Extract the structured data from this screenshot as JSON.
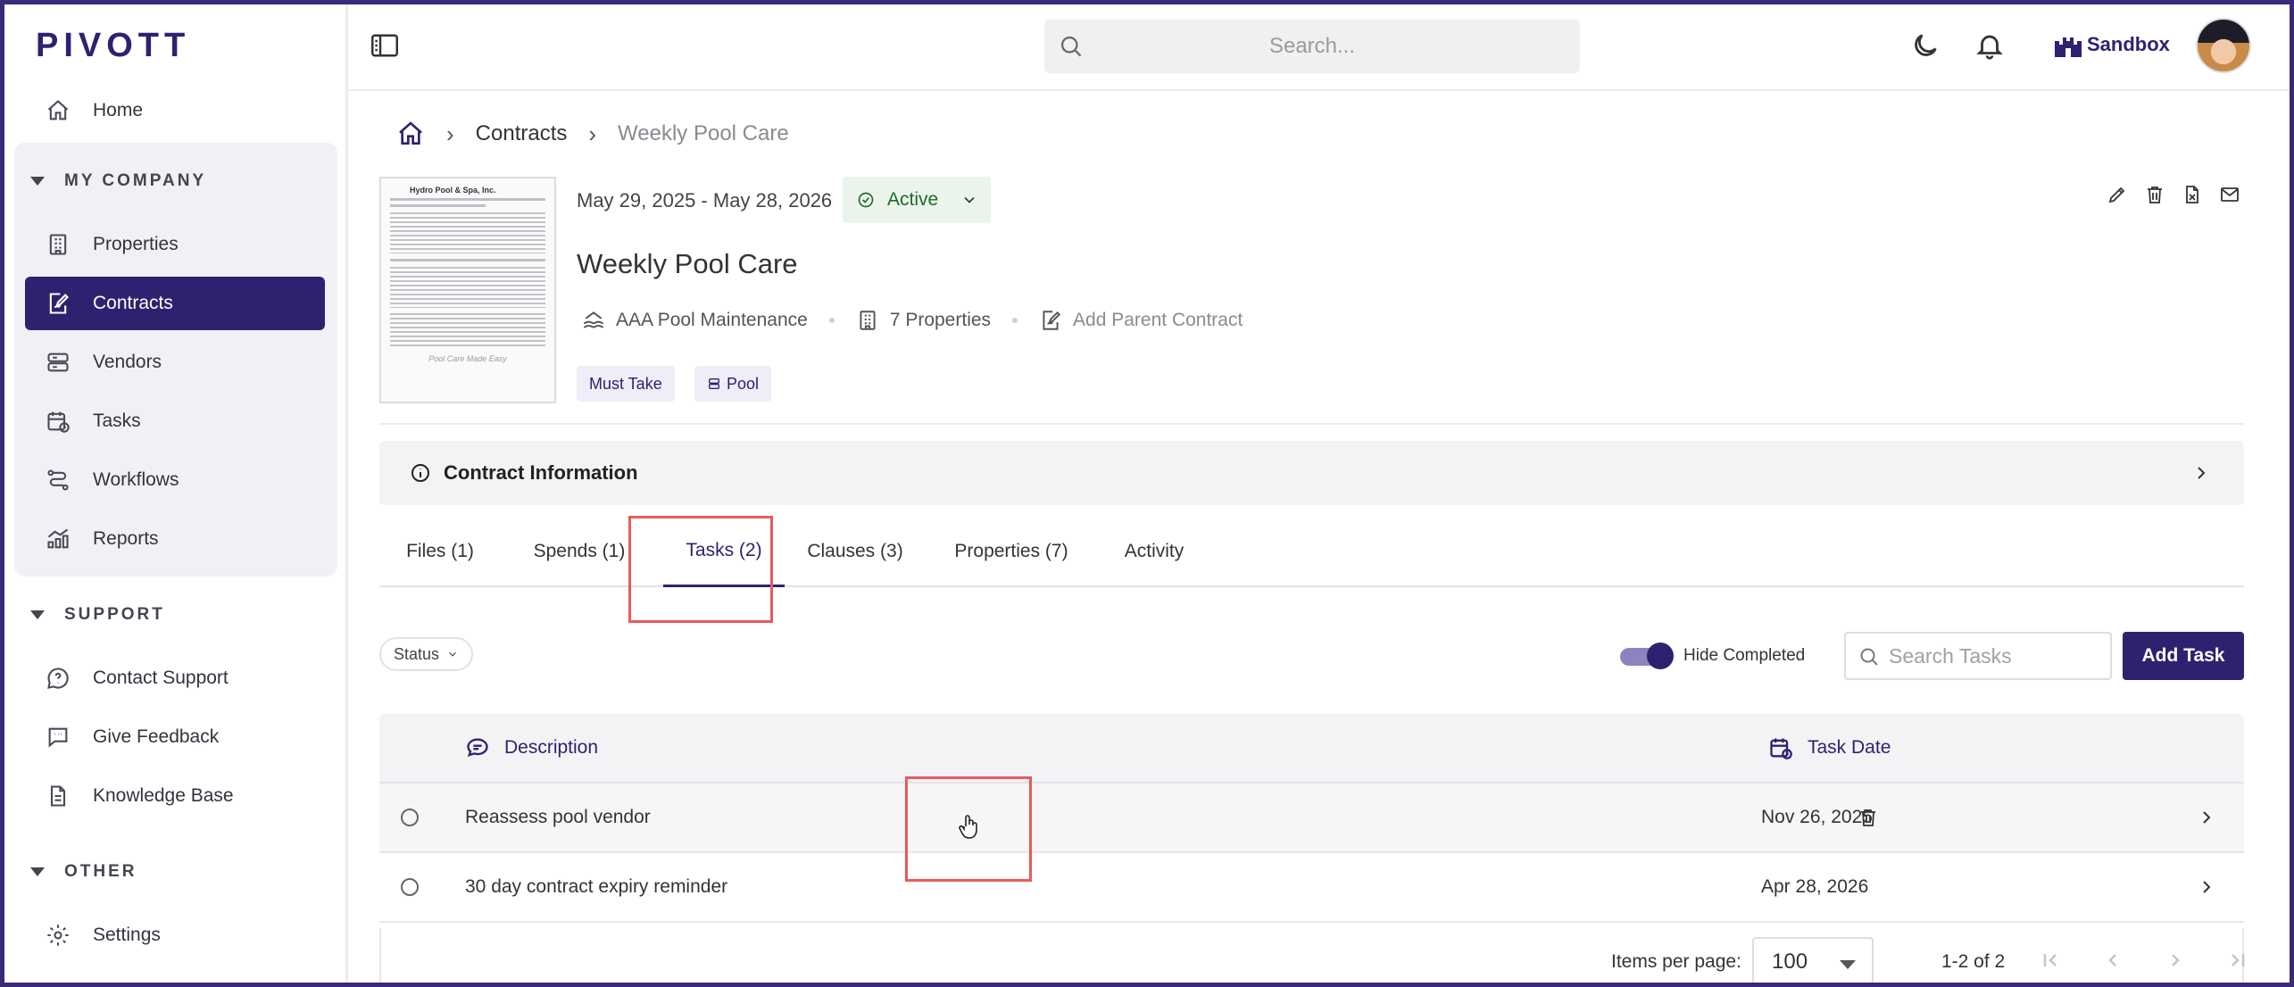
{
  "app": {
    "logo": "PIVOTT"
  },
  "sidebar": {
    "home": "Home",
    "sections": [
      {
        "title": "MY COMPANY"
      },
      {
        "title": "SUPPORT"
      },
      {
        "title": "OTHER"
      }
    ],
    "company_items": [
      "Properties",
      "Contracts",
      "Vendors",
      "Tasks",
      "Workflows",
      "Reports"
    ],
    "support_items": [
      "Contact Support",
      "Give Feedback",
      "Knowledge Base"
    ],
    "other_items": [
      "Settings"
    ],
    "active_item": "Contracts"
  },
  "topbar": {
    "search_placeholder": "Search...",
    "workspace": "Sandbox"
  },
  "breadcrumb": {
    "items": [
      "Contracts",
      "Weekly Pool Care"
    ]
  },
  "contract": {
    "dates": "May 29, 2025 - May 28, 2026",
    "status": "Active",
    "title": "Weekly Pool Care",
    "vendor": "AAA Pool Maintenance",
    "properties": "7 Properties",
    "parent_link": "Add Parent Contract",
    "tags": [
      "Must Take",
      "Pool"
    ],
    "thumbnail": {
      "header": "Hydro Pool & Spa, Inc.",
      "footer": "Pool Care Made Easy"
    }
  },
  "info_bar": {
    "label": "Contract Information"
  },
  "tabs": [
    {
      "label": "Files (1)"
    },
    {
      "label": "Spends (1)"
    },
    {
      "label": "Tasks (2)"
    },
    {
      "label": "Clauses (3)"
    },
    {
      "label": "Properties (7)"
    },
    {
      "label": "Activity"
    }
  ],
  "active_tab": "Tasks (2)",
  "tasks_toolbar": {
    "status_filter": "Status",
    "hide_completed_label": "Hide Completed",
    "hide_completed_on": true,
    "search_placeholder": "Search Tasks",
    "add_button": "Add Task"
  },
  "table": {
    "columns": {
      "description": "Description",
      "task_date": "Task Date"
    },
    "rows": [
      {
        "description": "Reassess pool vendor",
        "date": "Nov 26, 2025"
      },
      {
        "description": "30 day contract expiry reminder",
        "date": "Apr 28, 2026"
      }
    ]
  },
  "pagination": {
    "items_per_page_label": "Items per page:",
    "items_per_page": "100",
    "range": "1-2 of 2"
  },
  "colors": {
    "brand": "#2e2270",
    "active_status_bg": "#ebf4eb",
    "active_status_text": "#1e6b2a",
    "highlight": "#e85a5a"
  }
}
